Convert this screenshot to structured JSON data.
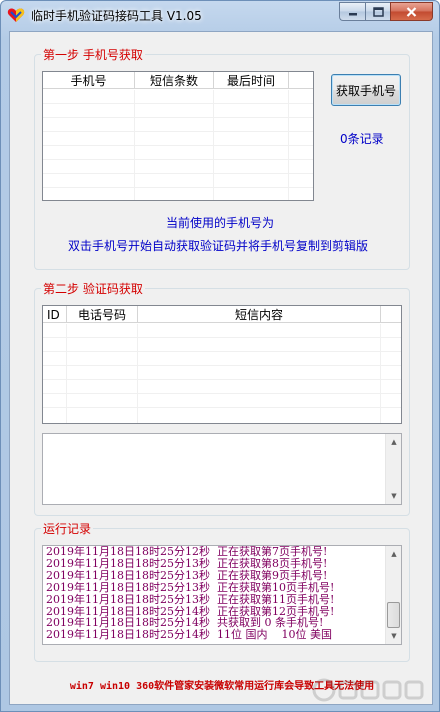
{
  "window": {
    "title": "临时手机验证码接码工具 V1.05",
    "controls": {
      "minimize": "—",
      "maximize": "□",
      "close": "✕"
    }
  },
  "step1": {
    "title": "第一步 手机号获取",
    "columns": [
      "手机号",
      "短信条数",
      "最后时间"
    ],
    "get_button": "获取手机号",
    "record_count": "0条记录",
    "current_phone_label": "当前使用的手机号为",
    "hint": "双击手机号开始自动获取验证码并将手机号复制到剪辑版"
  },
  "step2": {
    "title": "第二步 验证码获取",
    "columns": [
      "ID",
      "电话号码",
      "短信内容"
    ]
  },
  "log": {
    "title": "运行记录",
    "lines": [
      "2019年11月18日18时25分12秒  正在获取第7页手机号!",
      "2019年11月18日18时25分13秒  正在获取第8页手机号!",
      "2019年11月18日18时25分13秒  正在获取第9页手机号!",
      "2019年11月18日18时25分13秒  正在获取第10页手机号!",
      "2019年11月18日18时25分13秒  正在获取第11页手机号!",
      "2019年11月18日18时25分14秒  正在获取第12页手机号!",
      "2019年11月18日18时25分14秒  共获取到 0 条手机号!",
      "2019年11月18日18时25分14秒  11位 国内    10位 美国"
    ]
  },
  "footer": "win7 win10 360软件管家安装微软常用运行库会导致工具无法使用",
  "icons": {
    "app": "heart-app-icon",
    "watermark": "watermark-logo-icon"
  },
  "colors": {
    "group_title": "#d40000",
    "info_text": "#0000c8",
    "log_text": "#800060",
    "footer_text": "#c80000"
  }
}
